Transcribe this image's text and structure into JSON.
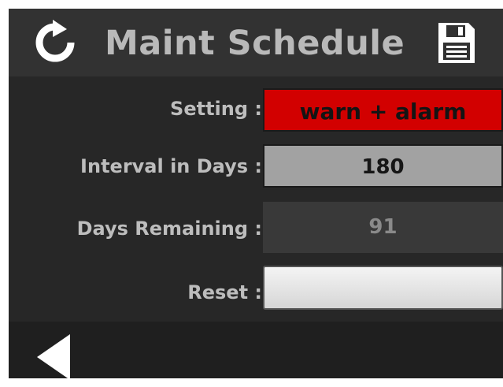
{
  "header": {
    "title": "Maint Schedule",
    "refresh_icon": "refresh-icon",
    "save_icon": "save-icon"
  },
  "rows": {
    "setting": {
      "label": "Setting :",
      "value": "warn + alarm"
    },
    "interval": {
      "label": "Interval in Days :",
      "value": "180"
    },
    "remaining": {
      "label": "Days Remaining :",
      "value": "91"
    },
    "reset": {
      "label": "Reset :"
    }
  },
  "footer": {
    "back_icon": "back-arrow-icon"
  },
  "colors": {
    "background": "#272727",
    "header": "#323232",
    "alarm_red": "#d20000",
    "field_gray": "#a2a2a2"
  }
}
